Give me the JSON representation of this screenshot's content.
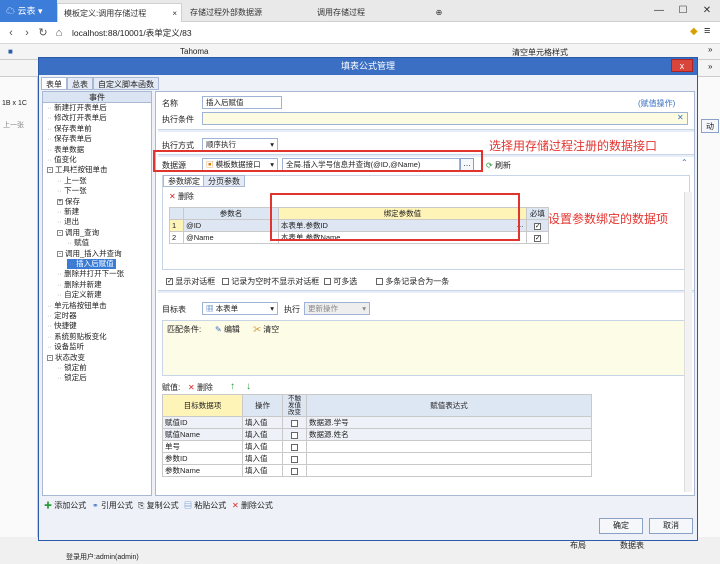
{
  "browser": {
    "cloud_label": "云表",
    "tabs": [
      "模板定义:调用存储过程",
      "存储过程外部数据源",
      "调用存储过程"
    ],
    "address": "localhost:88/10001/表单定义/83",
    "controls": [
      "—",
      "☐",
      "✕"
    ]
  },
  "app": {
    "toolbar_font": "Tahoma",
    "toolbar_clear": "清空单元格样式",
    "cell_ref": "1B x 1C",
    "right_btn": "动",
    "left_label": "上一张",
    "status_user": "登录用户:admin(admin)",
    "bottom_tabs": [
      "布局",
      "数据表"
    ]
  },
  "modal": {
    "title": "填表公式管理",
    "close": "x",
    "tabs": [
      "表单",
      "总表",
      "自定义脚本函数"
    ],
    "tree_header": "事件",
    "tree": [
      {
        "label": "新建打开表单后",
        "level": 1
      },
      {
        "label": "修改打开表单后",
        "level": 1
      },
      {
        "label": "保存表单前",
        "level": 1
      },
      {
        "label": "保存表单后",
        "level": 1
      },
      {
        "label": "表单数据",
        "level": 1
      },
      {
        "label": "值变化",
        "level": 1
      },
      {
        "label": "工具栏按钮单击",
        "level": 1,
        "expander": "-"
      },
      {
        "label": "上一张",
        "level": 2
      },
      {
        "label": "下一张",
        "level": 2
      },
      {
        "label": "保存",
        "level": 2,
        "expander": "+"
      },
      {
        "label": "新建",
        "level": 2
      },
      {
        "label": "退出",
        "level": 2
      },
      {
        "label": "调用_查询",
        "level": 2,
        "expander": "-"
      },
      {
        "label": "赋值",
        "level": 3
      },
      {
        "label": "调用_插入并查询",
        "level": 2,
        "expander": "-"
      },
      {
        "label": "插入后赋值",
        "level": 3,
        "selected": true
      },
      {
        "label": "删除并打开下一张",
        "level": 2
      },
      {
        "label": "删除并新建",
        "level": 2
      },
      {
        "label": "自定义新建",
        "level": 2
      },
      {
        "label": "单元格按钮单击",
        "level": 1
      },
      {
        "label": "定时器",
        "level": 1
      },
      {
        "label": "快捷键",
        "level": 1
      },
      {
        "label": "系统剪贴板变化",
        "level": 1
      },
      {
        "label": "设备监听",
        "level": 1
      },
      {
        "label": "状态改变",
        "level": 1,
        "expander": "-"
      },
      {
        "label": "锁定前",
        "level": 2
      },
      {
        "label": "锁定后",
        "level": 2
      }
    ],
    "name_label": "名称",
    "name_value": "插入后赋值",
    "name_hint": "(赋值操作)",
    "cond_label": "执行条件",
    "mode_label": "执行方式",
    "mode_value": "顺序执行",
    "ds_label": "数据源",
    "ds_type": "模板数据接口",
    "ds_value": "全局.插入学号信息并查询(@ID,@Name)",
    "ds_refresh": "刷新",
    "param_tabs": [
      "参数绑定",
      "分页参数"
    ],
    "param_delete": "删除",
    "param_headers": [
      "参数名",
      "绑定参数值",
      "必填"
    ],
    "params": [
      {
        "no": "1",
        "name": "@ID",
        "value": "本表单.参数ID",
        "required": true
      },
      {
        "no": "2",
        "name": "@Name",
        "value": "本表单.参数Name",
        "required": true
      }
    ],
    "options": [
      "显示对话框",
      "记录为空时不显示对话框",
      "可多选",
      "多条记录合为一条"
    ],
    "target_label": "目标表",
    "target_value": "本表单",
    "exec_label": "执行",
    "exec_value": "更新操作",
    "match_label": "匹配条件:",
    "match_edit": "编辑",
    "match_clear": "清空",
    "assign_label": "赋值:",
    "assign_delete": "删除",
    "assign_headers": [
      "目标数据项",
      "操作",
      "不触发值改变",
      "赋值表达式"
    ],
    "assigns": [
      {
        "target": "赋值ID",
        "op": "填入值",
        "expr": "数据源.学号"
      },
      {
        "target": "赋值Name",
        "op": "填入值",
        "expr": "数据源.姓名"
      },
      {
        "target": "单号",
        "op": "填入值",
        "expr": ""
      },
      {
        "target": "参数ID",
        "op": "填入值",
        "expr": ""
      },
      {
        "target": "参数Name",
        "op": "填入值",
        "expr": ""
      }
    ],
    "bottom_actions": [
      "添加公式",
      "引用公式",
      "复制公式",
      "粘贴公式",
      "删除公式"
    ],
    "ok": "确定",
    "cancel": "取消"
  },
  "annotations": {
    "a1": "选择用存储过程注册的数据接口",
    "a2": "设置参数绑定的数据项"
  }
}
